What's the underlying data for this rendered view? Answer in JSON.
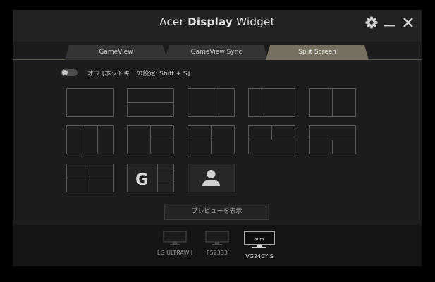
{
  "window": {
    "title_prefix": "Acer ",
    "title_bold": "Display",
    "title_suffix": " Widget",
    "controls": {
      "settings_icon": "gear-icon",
      "minimize_icon": "minimize-icon",
      "close_icon": "close-icon"
    }
  },
  "tabs": [
    {
      "label": "GameView",
      "active": false
    },
    {
      "label": "GameView Sync",
      "active": false
    },
    {
      "label": "Split Screen",
      "active": true
    }
  ],
  "hotkey": {
    "state": "off",
    "text": "オフ [ホットキーの設定: Shift + S]"
  },
  "layouts": [
    "single",
    "two-rows",
    "two-cols-wide-left",
    "two-cols-narrow-left",
    "two-cols-equal",
    "three-cols",
    "left-full-right-split",
    "left-split-right-full",
    "top-split-bottom-full",
    "top-full-bottom-split",
    "quad",
    "gameview-g",
    "avatar"
  ],
  "icons": {
    "gameview_layout": "G",
    "avatar_layout": "person-icon"
  },
  "preview_button": "プレビューを表示",
  "monitors": [
    {
      "label": "LG ULTRAWII",
      "icon": "monitor-icon",
      "selected": false
    },
    {
      "label": "F52333",
      "icon": "monitor-icon",
      "selected": false
    },
    {
      "label": "VG240Y S",
      "icon": "monitor-acer-icon",
      "brand": "acer",
      "selected": true
    }
  ],
  "colors": {
    "window_bg": "#1c1c1c",
    "active_tab": "#75705f",
    "tab": "#343434",
    "layout_stroke": "#5a5a5a"
  }
}
